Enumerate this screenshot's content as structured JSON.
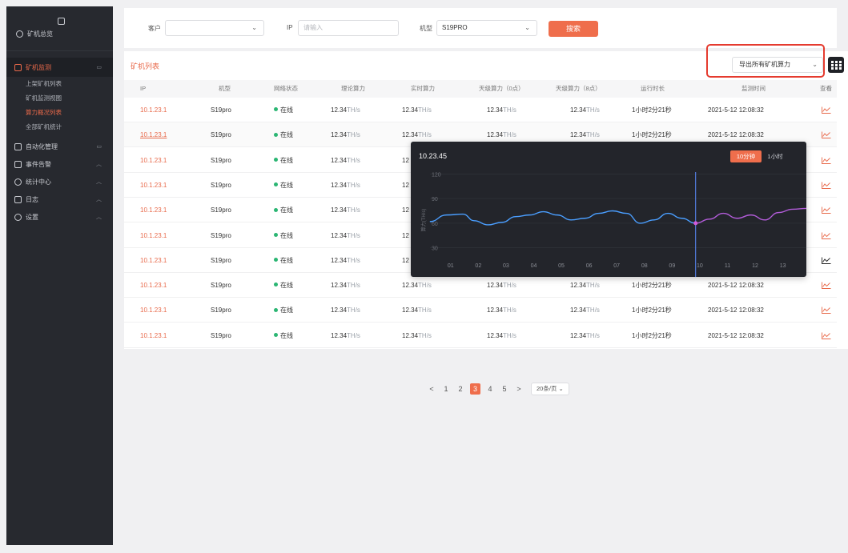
{
  "sidebar": {
    "overview": "矿机总览",
    "monitor": "矿机监测",
    "monitor_items": [
      "上架矿机列表",
      "矿机监测视图",
      "算力概况列表",
      "全部矿机统计"
    ],
    "groups": [
      "自动化管理",
      "事件告警",
      "统计中心",
      "日志",
      "设置"
    ]
  },
  "filters": {
    "customer_label": "客户",
    "customer_value": "",
    "ip_label": "IP",
    "ip_placeholder": "请输入",
    "model_label": "机型",
    "model_value": "S19PRO",
    "search_label": "搜索"
  },
  "panel": {
    "title": "矿机列表",
    "export_label": "导出所有矿机算力"
  },
  "table": {
    "headers": [
      "IP",
      "机型",
      "网络状态",
      "理论算力",
      "实时算力",
      "天级算力（0点）",
      "天级算力（8点）",
      "运行时长",
      "监测时间",
      "查看"
    ],
    "rows": [
      {
        "ip": "10.1.23.1",
        "model": "S19pro",
        "status": "在线",
        "theory": "12.34",
        "realtime": "12.34",
        "day0": "12.34",
        "day8": "12.34",
        "runtime": "1小时2分21秒",
        "time": "2021-5-12 12:08:32"
      },
      {
        "ip": "10.1.23.1",
        "model": "S19pro",
        "status": "在线",
        "theory": "12.34",
        "realtime": "12.34",
        "day0": "12.34",
        "day8": "12.34",
        "runtime": "1小时2分21秒",
        "time": "2021-5-12 12:08:32"
      },
      {
        "ip": "10.1.23.1",
        "model": "S19pro",
        "status": "在线",
        "theory": "12.34",
        "realtime": "12",
        "day0": "",
        "day8": "",
        "runtime": "",
        "time": ""
      },
      {
        "ip": "10.1.23.1",
        "model": "S19pro",
        "status": "在线",
        "theory": "12.34",
        "realtime": "12",
        "day0": "",
        "day8": "",
        "runtime": "",
        "time": ""
      },
      {
        "ip": "10.1.23.1",
        "model": "S19pro",
        "status": "在线",
        "theory": "12.34",
        "realtime": "12",
        "day0": "",
        "day8": "",
        "runtime": "",
        "time": ""
      },
      {
        "ip": "10.1.23.1",
        "model": "S19pro",
        "status": "在线",
        "theory": "12.34",
        "realtime": "12",
        "day0": "",
        "day8": "",
        "runtime": "",
        "time": ""
      },
      {
        "ip": "10.1.23.1",
        "model": "S19pro",
        "status": "在线",
        "theory": "12.34",
        "realtime": "12",
        "day0": "",
        "day8": "",
        "runtime": "",
        "time": ""
      },
      {
        "ip": "10.1.23.1",
        "model": "S19pro",
        "status": "在线",
        "theory": "12.34",
        "realtime": "12.34",
        "day0": "12.34",
        "day8": "12.34",
        "runtime": "1小时2分21秒",
        "time": "2021-5-12 12:08:32"
      },
      {
        "ip": "10.1.23.1",
        "model": "S19pro",
        "status": "在线",
        "theory": "12.34",
        "realtime": "12.34",
        "day0": "12.34",
        "day8": "12.34",
        "runtime": "1小时2分21秒",
        "time": "2021-5-12 12:08:32"
      },
      {
        "ip": "10.1.23.1",
        "model": "S19pro",
        "status": "在线",
        "theory": "12.34",
        "realtime": "12.34",
        "day0": "12.34",
        "day8": "12.34",
        "runtime": "1小时2分21秒",
        "time": "2021-5-12 12:08:32"
      }
    ],
    "unit": "TH/s"
  },
  "popup": {
    "title": "10.23.45",
    "range_on": "10分钟",
    "range_off": "1小时"
  },
  "chart_data": {
    "type": "line",
    "title": "10.23.45",
    "xlabel": "",
    "ylabel": "算力(TH/s)",
    "ylim": [
      20,
      130
    ],
    "yticks": [
      30,
      60,
      90,
      120
    ],
    "categories": [
      "01",
      "02",
      "03",
      "04",
      "05",
      "06",
      "07",
      "08",
      "09",
      "10",
      "11",
      "12",
      "13"
    ],
    "x": [
      0.4,
      1,
      1.6,
      2,
      2.5,
      3,
      3.5,
      4,
      4.5,
      5,
      5.5,
      6,
      6.5,
      7,
      7.5,
      8,
      8.5,
      9,
      9.5,
      10,
      10.5,
      11,
      11.5,
      12,
      12.5,
      13,
      13.5,
      14
    ],
    "series": [
      {
        "values": [
          62,
          70,
          71,
          63,
          58,
          61,
          68,
          70,
          74,
          70,
          64,
          66,
          72,
          75,
          72,
          60,
          64,
          72,
          66,
          60,
          65,
          72,
          66,
          70,
          64,
          73,
          77,
          78
        ]
      }
    ],
    "highlight_x": 10,
    "highlight_y": 60,
    "grid": true,
    "colors": {
      "series": "#4a9eff",
      "series_after": "#b25cd9",
      "cursor": "#5b8cff"
    }
  },
  "pagination": {
    "prev": "<",
    "pages": [
      "1",
      "2",
      "3",
      "4",
      "5"
    ],
    "current": "3",
    "next": ">",
    "page_size": "20条/页"
  }
}
